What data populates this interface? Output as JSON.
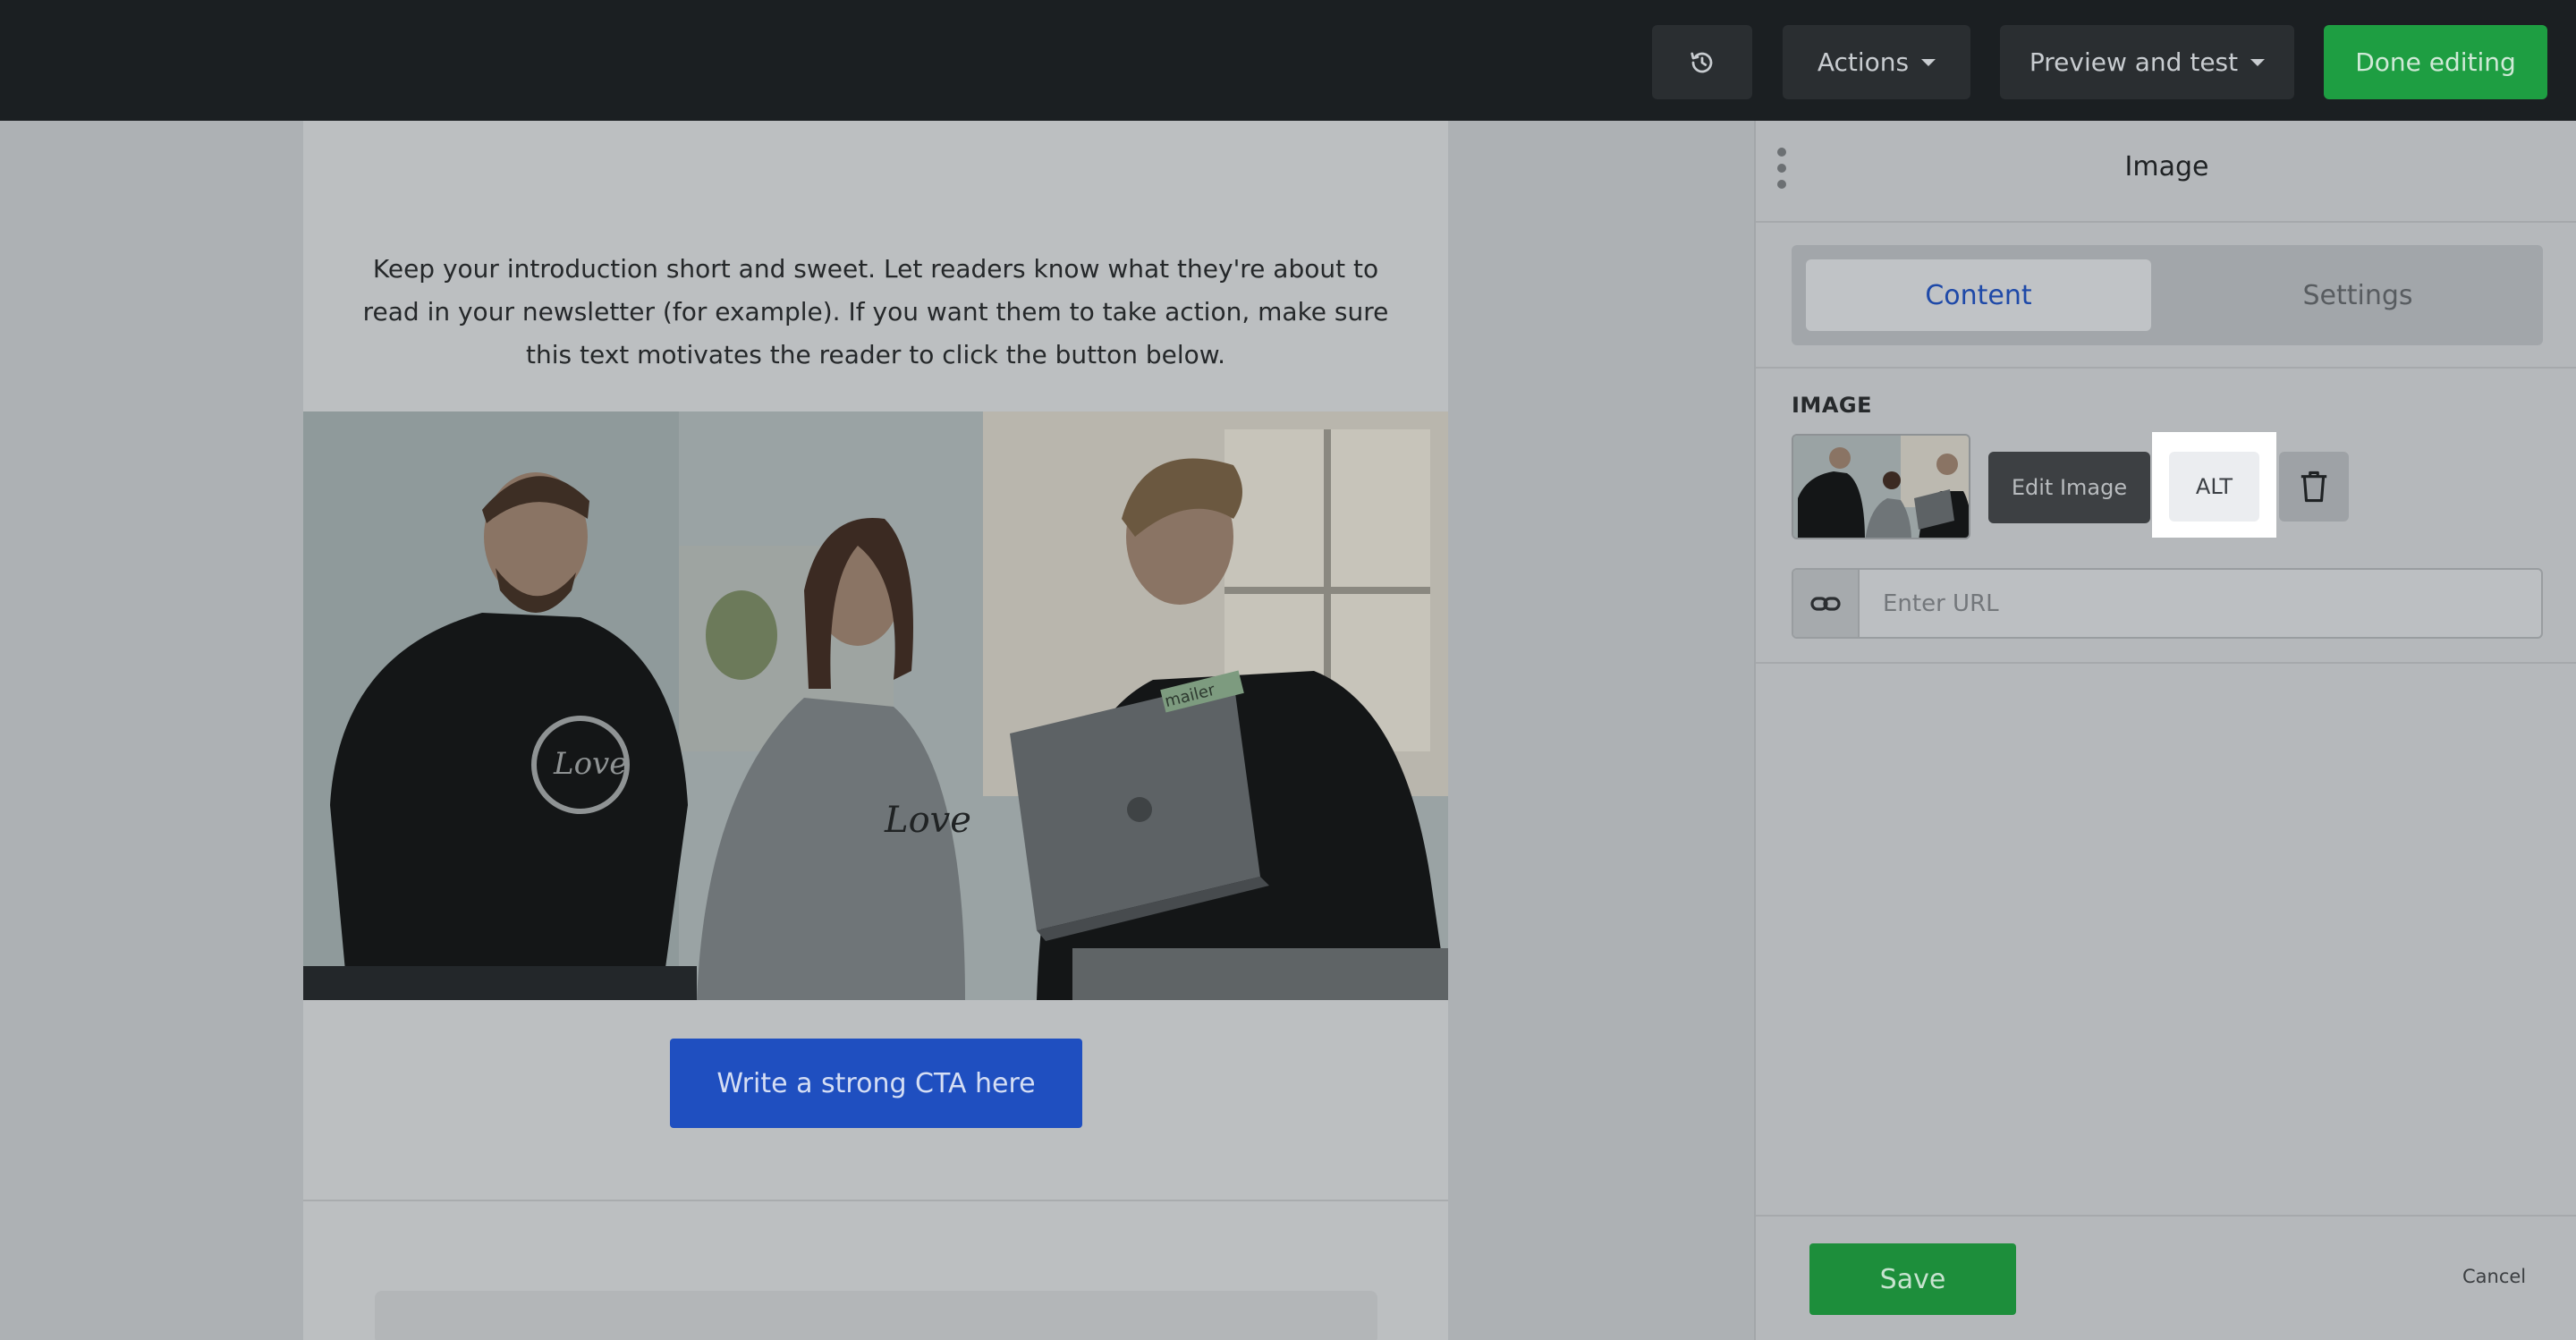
{
  "topbar": {
    "history_icon": "history-icon",
    "actions_label": "Actions",
    "preview_label": "Preview and test",
    "done_label": "Done editing",
    "colors": {
      "background": "#1b1f22",
      "done_button": "#1e9e42"
    }
  },
  "email": {
    "intro_text": "Keep your introduction short and sweet. Let readers know what they're about to read in your newsletter (for example). If you want them to take action, make sure this text motivates the reader to click the button below.",
    "cta_label": "Write a strong CTA here",
    "cta_color": "#1f4fc0"
  },
  "panel": {
    "title": "Image",
    "tabs": [
      {
        "label": "Content",
        "active": true
      },
      {
        "label": "Settings",
        "active": false
      }
    ],
    "section_label": "IMAGE",
    "edit_image_label": "Edit Image",
    "alt_label": "ALT",
    "url_placeholder": "Enter URL",
    "save_label": "Save",
    "cancel_label": "Cancel",
    "colors": {
      "accent": "#1e49a8",
      "save": "#1d8e3b"
    }
  }
}
